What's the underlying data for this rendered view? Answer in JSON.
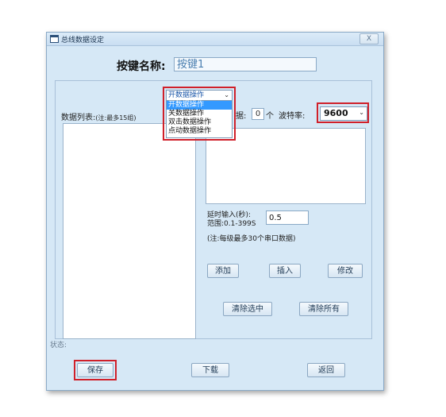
{
  "window": {
    "title": "总线数据设定",
    "close_label": "X"
  },
  "key_name": {
    "label": "按键名称:",
    "value": "按键1"
  },
  "data_list": {
    "label": "数据列表:",
    "note": "(注:最多15组)"
  },
  "operation": {
    "selected": "开数据操作",
    "options": [
      "开数据操作",
      "关数据操作",
      "双击数据操作",
      "点动数据操作"
    ],
    "highlighted_index": 0
  },
  "data_count": {
    "label": "据:",
    "value": "0",
    "unit": "个"
  },
  "baud": {
    "label": "波特率:",
    "value": "9600"
  },
  "delay": {
    "label_line1": "延时输入(秒):",
    "label_line2": "范围:0.1-399S",
    "value": "0.5"
  },
  "note": "(注:每级最多30个串口数据)",
  "buttons": {
    "add": "添加",
    "insert": "插入",
    "modify": "修改",
    "clear_selected": "清除选中",
    "clear_all": "清除所有",
    "save": "保存",
    "download": "下载",
    "back": "返回"
  },
  "status": {
    "label": "状态:"
  },
  "colors": {
    "highlight": "#d0202a",
    "window_bg": "#d6e8f6",
    "dropdown_active": "#3399ff"
  }
}
